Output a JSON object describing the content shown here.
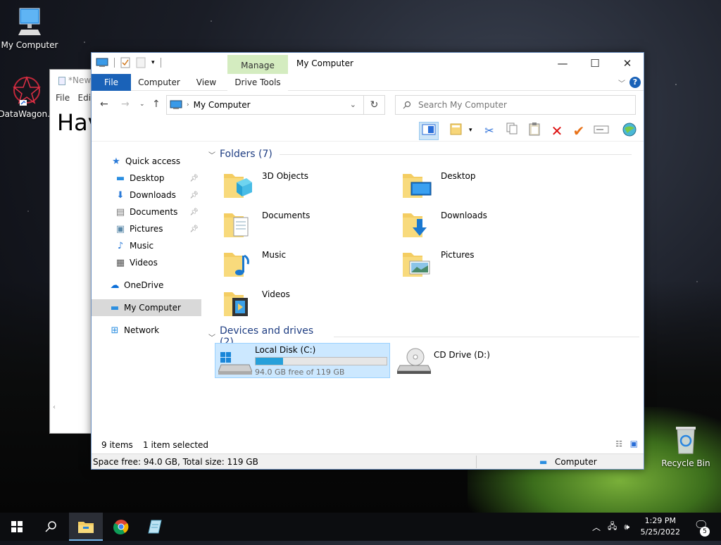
{
  "desktop": {
    "icons": [
      {
        "label": "My Computer"
      },
      {
        "label": "DataWagon..."
      },
      {
        "label": "Recycle Bin"
      }
    ]
  },
  "notepad": {
    "title": "*New",
    "menu_file": "File",
    "menu_edit": "Edit",
    "text": "Hav"
  },
  "explorer": {
    "title": "My Computer",
    "manage_tab": "Manage",
    "tabs": {
      "file": "File",
      "computer": "Computer",
      "view": "View",
      "drive_tools": "Drive Tools"
    },
    "help": "?",
    "address": "My Computer",
    "search_placeholder": "Search My Computer",
    "nav": [
      {
        "label": "Quick access"
      },
      {
        "label": "Desktop"
      },
      {
        "label": "Downloads"
      },
      {
        "label": "Documents"
      },
      {
        "label": "Pictures"
      },
      {
        "label": "Music"
      },
      {
        "label": "Videos"
      },
      {
        "label": "OneDrive"
      },
      {
        "label": "My Computer"
      },
      {
        "label": "Network"
      }
    ],
    "folders_header": "Folders (7)",
    "folders": [
      {
        "name": "3D Objects"
      },
      {
        "name": "Desktop"
      },
      {
        "name": "Documents"
      },
      {
        "name": "Downloads"
      },
      {
        "name": "Music"
      },
      {
        "name": "Pictures"
      },
      {
        "name": "Videos"
      }
    ],
    "devices_header": "Devices and drives (2)",
    "drives": [
      {
        "name": "Local Disk (C:)",
        "free_text": "94.0 GB free of 119 GB",
        "used_fraction": 0.21
      },
      {
        "name": "CD Drive (D:)"
      }
    ],
    "status": {
      "items": "9 items",
      "selected": "1 item selected"
    },
    "details": {
      "space": "Space free: 94.0 GB, Total size: 119 GB",
      "location": "Computer"
    }
  },
  "taskbar": {
    "time": "1:29 PM",
    "date": "5/25/2022",
    "notifications": "5"
  }
}
